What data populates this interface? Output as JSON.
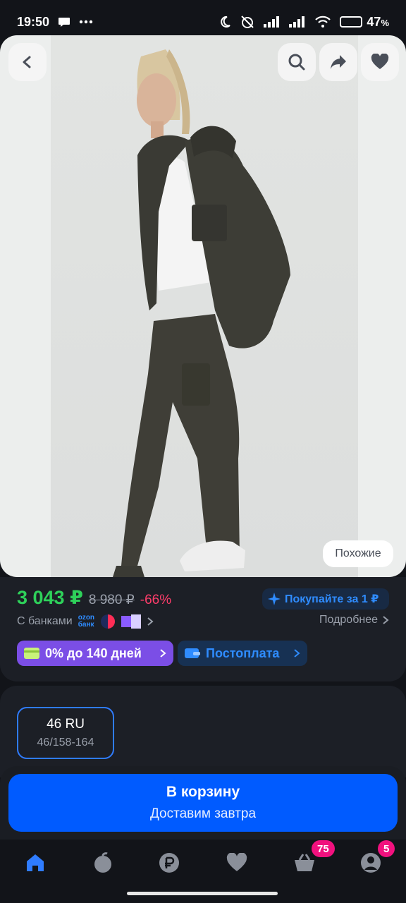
{
  "status_bar": {
    "time": "19:50",
    "battery_percent": "47",
    "battery_suffix": "%",
    "battery_level": 0.47,
    "icons": [
      "chat-bubble-icon",
      "more-dots-icon",
      "moon-icon",
      "mute-alarm-icon",
      "signal-icon",
      "signal-icon",
      "wifi-icon",
      "battery-icon"
    ]
  },
  "product_image": {
    "similar_label": "Похожие",
    "overlay_icons": [
      "back-icon",
      "search-icon",
      "share-icon",
      "heart-icon"
    ]
  },
  "pricing": {
    "price": "3 043 ₽",
    "old_price": "8 980 ₽",
    "discount": "-66%",
    "promo_label": "Покупайте за 1 ₽",
    "banks_label": "С банками",
    "ozon_bank_line1": "ozon",
    "ozon_bank_line2": "банк",
    "more_label": "Подробнее",
    "installments_label": "0% до 140 дней",
    "postpay_label": "Постоплата",
    "colors": {
      "price": "#2ed15a",
      "discount": "#ff3d6b",
      "accent": "#005bff",
      "installments": "#7b4ee6"
    }
  },
  "size": {
    "selected_label": "46 RU",
    "selected_sub": "46/158-164"
  },
  "cart": {
    "title": "В корзину",
    "subtitle": "Доставим завтра"
  },
  "bottom_nav": {
    "items": [
      "home-icon",
      "fresh-icon",
      "ruble-icon",
      "favorites-icon",
      "cart-icon",
      "profile-icon"
    ],
    "cart_badge": "75",
    "profile_badge": "5"
  }
}
